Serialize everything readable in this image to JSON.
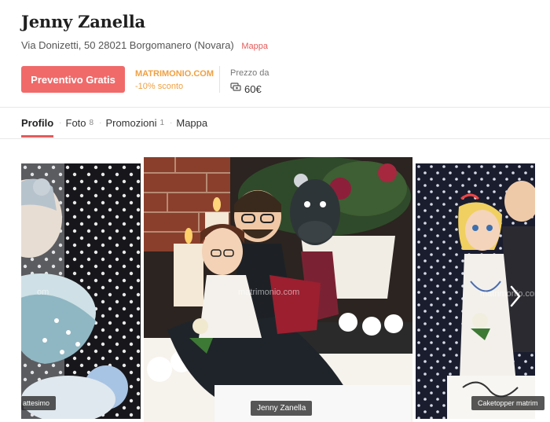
{
  "vendor": {
    "name": "Jenny Zanella",
    "address": "Via Donizetti, 50 28021 Borgomanero (Novara)",
    "map_link": "Mappa"
  },
  "actions": {
    "quote_button": "Preventivo Gratis",
    "promo_brand": "MATRIMONIO.COM",
    "promo_discount": "-10% sconto",
    "price_label": "Prezzo da",
    "price_value": "60€"
  },
  "tabs": [
    {
      "label": "Profilo",
      "count": ""
    },
    {
      "label": "Foto",
      "count": "8"
    },
    {
      "label": "Promozioni",
      "count": "1"
    },
    {
      "label": "Mappa",
      "count": ""
    }
  ],
  "gallery": {
    "captions": {
      "left": "attesimo",
      "center": "Jenny Zanella",
      "right": "Caketopper matrim"
    },
    "watermarks": {
      "center": "matrimonio.com",
      "left": "om",
      "right": "matrimonio.com"
    }
  },
  "colors": {
    "accent": "#f06a6a",
    "promo": "#f0a040"
  }
}
